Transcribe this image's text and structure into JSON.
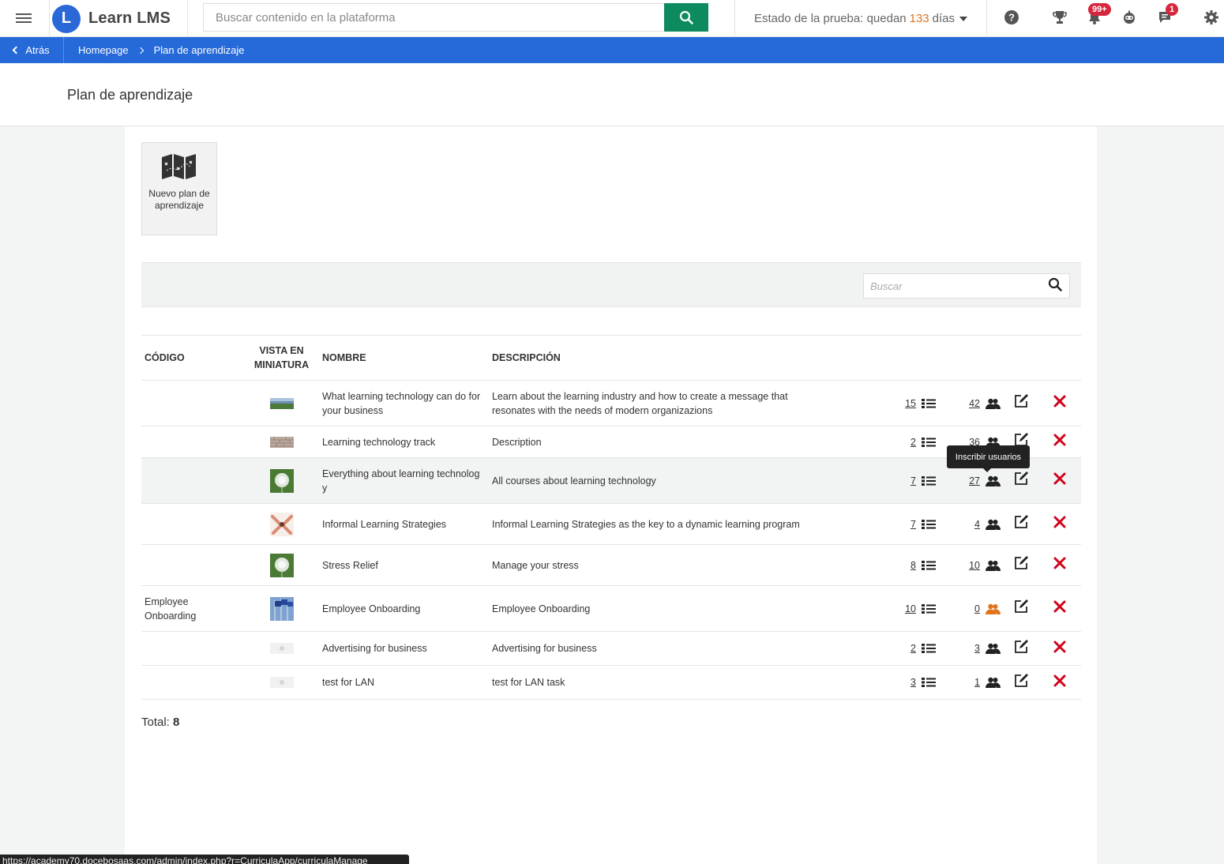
{
  "app": {
    "name": "Learn LMS",
    "logo_letter": "L"
  },
  "search": {
    "placeholder": "Buscar contenido en la plataforma"
  },
  "trial": {
    "prefix": "Estado de la prueba: quedan",
    "days": "133",
    "suffix": "días"
  },
  "header_icons": [
    {
      "name": "help-icon"
    },
    {
      "name": "trophy-icon"
    },
    {
      "name": "notifications-icon",
      "badge": "99+"
    },
    {
      "name": "bot-icon"
    },
    {
      "name": "messages-icon",
      "badge": "1"
    },
    {
      "name": "gear-icon"
    }
  ],
  "breadcrumb": {
    "back_label": "Atrás",
    "items": [
      "Homepage",
      "Plan de aprendizaje"
    ]
  },
  "page": {
    "title": "Plan de aprendizaje"
  },
  "new_plan": {
    "label": "Nuevo plan de aprendizaje"
  },
  "filter": {
    "placeholder": "Buscar"
  },
  "table": {
    "columns": {
      "code": "CÓDIGO",
      "thumbnail": "VISTA EN MINIATURA",
      "name": "NOMBRE",
      "description": "DESCRIPCIÓN"
    },
    "rows": [
      {
        "code": "",
        "name": "What learning technology can do for your business",
        "description": "Learn about the learning industry and how to create a message that resonates with the needs of modern organizazions",
        "courses": "15",
        "users": "42",
        "thumb": "landscape"
      },
      {
        "code": "",
        "name": "Learning technology track",
        "description": "Description",
        "courses": "2",
        "users": "36",
        "thumb": "bricks"
      },
      {
        "code": "",
        "name": "Everything about learning technolog y",
        "description": "All courses about learning technology",
        "courses": "7",
        "users": "27",
        "thumb": "dandelion"
      },
      {
        "code": "",
        "name": "Informal Learning Strategies",
        "description": "Informal Learning Strategies as the key to a dynamic learning program",
        "courses": "7",
        "users": "4",
        "thumb": "hands"
      },
      {
        "code": "",
        "name": "Stress Relief",
        "description": "Manage your stress",
        "courses": "8",
        "users": "10",
        "thumb": "dandelion"
      },
      {
        "code": "Employee Onboarding",
        "name": "Employee Onboarding",
        "description": "Employee Onboarding",
        "courses": "10",
        "users": "0",
        "thumb": "flags"
      },
      {
        "code": "",
        "name": "Advertising for business",
        "description": "Advertising for business",
        "courses": "2",
        "users": "3",
        "thumb": "placeholder"
      },
      {
        "code": "",
        "name": "test for LAN",
        "description": "test for LAN task",
        "courses": "3",
        "users": "1",
        "thumb": "placeholder"
      }
    ]
  },
  "tooltip": {
    "text": "Inscribir usuarios"
  },
  "total": {
    "label": "Total:",
    "value": "8"
  },
  "status_url": "https://academy70.docebosaas.com/admin/index.php?r=CurriculaApp/curriculaManage",
  "colors": {
    "primary": "#2669d9",
    "accent": "#e0731d",
    "search_button": "#0e8a5f",
    "delete": "#d0021b",
    "badge": "#d7263d"
  }
}
